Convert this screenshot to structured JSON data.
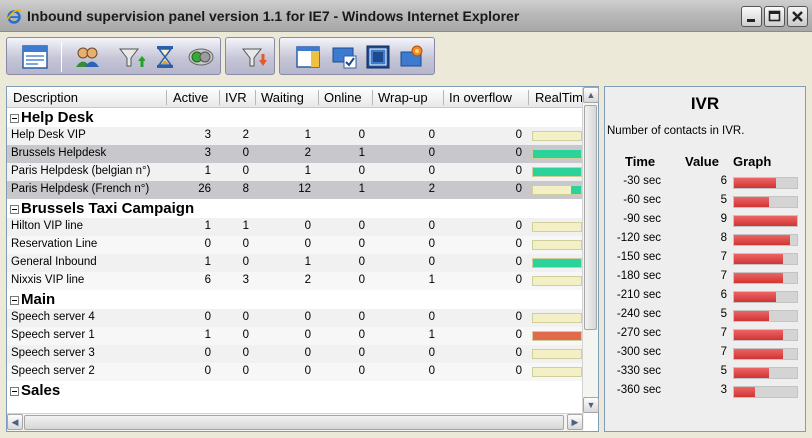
{
  "window": {
    "title": "Inbound supervision panel version 1.1 for IE7 - Windows Internet Explorer",
    "icons": [
      "ie-logo-icon",
      "minimize-icon",
      "maximize-icon",
      "close-icon"
    ]
  },
  "toolbar": {
    "group1": [
      "panel-view-icon"
    ],
    "group2": [
      "agents-icon",
      "filter-up-icon",
      "hourglass-icon",
      "toggle-icon"
    ],
    "group3": [
      "filter-down-icon"
    ],
    "group4": [
      "layout-icon",
      "check-monitor-icon",
      "windows-icon",
      "settings-icon"
    ]
  },
  "grid": {
    "columns": [
      "Description",
      "Active",
      "IVR",
      "Waiting",
      "Online",
      "Wrap-up",
      "In overflow",
      "RealTim"
    ],
    "groups": [
      {
        "name": "Help Desk",
        "rows": [
          {
            "desc": "Help Desk VIP",
            "active": "3",
            "ivr": "2",
            "waiting": "1",
            "online": "0",
            "wrapup": "0",
            "overflow": "0",
            "level": 0.05,
            "color": "#f2f0c4"
          },
          {
            "desc": "Brussels Helpdesk",
            "active": "3",
            "ivr": "0",
            "waiting": "2",
            "online": "1",
            "wrapup": "0",
            "overflow": "0",
            "level": 1.0,
            "color": "#2bd39a",
            "selected": true
          },
          {
            "desc": "Paris Helpdesk (belgian n°)",
            "active": "1",
            "ivr": "0",
            "waiting": "1",
            "online": "0",
            "wrapup": "0",
            "overflow": "0",
            "level": 1.0,
            "color": "#2bd39a"
          },
          {
            "desc": "Paris Helpdesk (French n°)",
            "active": "26",
            "ivr": "8",
            "waiting": "12",
            "online": "1",
            "wrapup": "2",
            "overflow": "0",
            "level": 0.2,
            "color": "#2bd39a",
            "reverse": true,
            "selected": true
          }
        ]
      },
      {
        "name": "Brussels Taxi Campaign",
        "rows": [
          {
            "desc": "Hilton VIP line",
            "active": "1",
            "ivr": "1",
            "waiting": "0",
            "online": "0",
            "wrapup": "0",
            "overflow": "0",
            "level": 0.05,
            "color": "#f2f0c4"
          },
          {
            "desc": "Reservation Line",
            "active": "0",
            "ivr": "0",
            "waiting": "0",
            "online": "0",
            "wrapup": "0",
            "overflow": "0",
            "level": 0,
            "color": "#f2f0c4"
          },
          {
            "desc": "General Inbound",
            "active": "1",
            "ivr": "0",
            "waiting": "1",
            "online": "0",
            "wrapup": "0",
            "overflow": "0",
            "level": 1.0,
            "color": "#2bd39a"
          },
          {
            "desc": "Nixxis VIP line",
            "active": "6",
            "ivr": "3",
            "waiting": "2",
            "online": "0",
            "wrapup": "1",
            "overflow": "0",
            "level": 0.05,
            "color": "#f2f0c4"
          }
        ]
      },
      {
        "name": "Main",
        "rows": [
          {
            "desc": "Speech server 4",
            "active": "0",
            "ivr": "0",
            "waiting": "0",
            "online": "0",
            "wrapup": "0",
            "overflow": "0",
            "level": 0,
            "color": "#f2f0c4"
          },
          {
            "desc": "Speech server 1",
            "active": "1",
            "ivr": "0",
            "waiting": "0",
            "online": "0",
            "wrapup": "1",
            "overflow": "0",
            "level": 1.0,
            "color": "#e06a4c"
          },
          {
            "desc": "Speech server 3",
            "active": "0",
            "ivr": "0",
            "waiting": "0",
            "online": "0",
            "wrapup": "0",
            "overflow": "0",
            "level": 0,
            "color": "#f2f0c4"
          },
          {
            "desc": "Speech server 2",
            "active": "0",
            "ivr": "0",
            "waiting": "0",
            "online": "0",
            "wrapup": "0",
            "overflow": "0",
            "level": 0,
            "color": "#f2f0c4"
          }
        ]
      },
      {
        "name": "Sales",
        "rows": []
      }
    ]
  },
  "ivr_panel": {
    "title": "IVR",
    "subtitle": "Number of contacts in IVR.",
    "headers": [
      "Time",
      "Value",
      "Graph"
    ],
    "max_value": 9,
    "rows": [
      {
        "time": "-30 sec",
        "value": 6
      },
      {
        "time": "-60 sec",
        "value": 5
      },
      {
        "time": "-90 sec",
        "value": 9
      },
      {
        "time": "-120 sec",
        "value": 8
      },
      {
        "time": "-150 sec",
        "value": 7
      },
      {
        "time": "-180 sec",
        "value": 7
      },
      {
        "time": "-210 sec",
        "value": 6
      },
      {
        "time": "-240 sec",
        "value": 5
      },
      {
        "time": "-270 sec",
        "value": 7
      },
      {
        "time": "-300 sec",
        "value": 7
      },
      {
        "time": "-330 sec",
        "value": 5
      },
      {
        "time": "-360 sec",
        "value": 3
      }
    ]
  }
}
